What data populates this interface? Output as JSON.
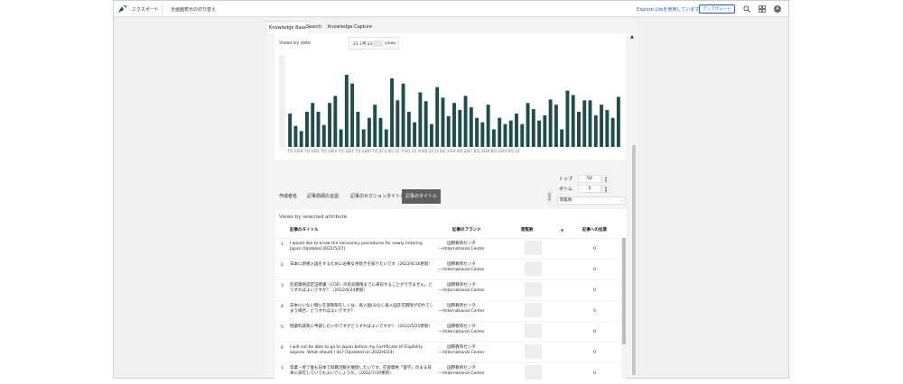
{
  "topbar": {
    "export_label": "エクスポート",
    "fullscreen_label": "全画面表示の切り替え",
    "explore_label": "Explore Lifeを使用しています",
    "upgrade_label": "アップグレード",
    "avatar_initial": "A",
    "icons": [
      "search-icon",
      "grid-icon",
      "apps-icon",
      "avatar"
    ]
  },
  "tabs": [
    "Knowledge Base",
    "Search",
    "Knowledge Capture"
  ],
  "chart": {
    "title": "Views by date",
    "tooltip_date": "21 7月 22",
    "tooltip_suffix": "views",
    "bar_color": "#1e4d4b"
  },
  "chart_data": {
    "type": "bar",
    "title": "Views by date",
    "x_tick_labels": [
      "15 7月 22",
      "18 7月 22",
      "21 7月 22",
      "24 7月 22",
      "27 7月 22",
      "30 7月 22",
      "2 8月 22",
      "5 8月 22",
      "8 8月 22",
      "11 8月 22",
      "14 8月 22",
      "17 8月 22",
      "20 8月 22",
      "23 8月 22"
    ],
    "values": [
      38,
      24,
      18,
      40,
      50,
      40,
      25,
      50,
      58,
      20,
      82,
      72,
      40,
      20,
      33,
      48,
      33,
      20,
      78,
      53,
      72,
      40,
      28,
      62,
      52,
      26,
      68,
      56,
      35,
      50,
      42,
      58,
      45,
      33,
      28,
      48,
      20,
      33,
      26,
      30,
      38,
      26,
      50,
      43,
      30,
      36,
      54,
      48,
      20,
      64,
      59,
      40,
      53,
      53,
      36,
      48,
      42,
      33,
      57
    ]
  },
  "attribute_tabs": [
    "作成者名",
    "記事前頭の言語",
    "記事のセクションタイトル",
    "記事のタイトル"
  ],
  "controls": {
    "top_label": "トップ",
    "top_value": "50",
    "bottom_label": "ボトム",
    "bottom_value": "0",
    "metric_value": "閲覧数"
  },
  "table": {
    "title": "Views by selected attribute",
    "headers": {
      "title": "記事のタイトル",
      "brand": "記事のブランド",
      "views": "閲覧数",
      "likes": "記事への投票"
    },
    "rows": [
      {
        "n": "1",
        "title": "I would like to know the necessary procedures for newly entering Japan (Updated 2022/5/27)",
        "brand": "国際教育センター/International Center",
        "likes": "0"
      },
      {
        "n": "2",
        "title": "日本に新規入国をするために必要な手続きを知りたいです（2022/6/16更新）",
        "brand": "国際教育センター/International Center",
        "likes": "0"
      },
      {
        "n": "3",
        "title": "在留資格認定証明書（COE）の有効期限までに来日することができません。どうすればよいですか？（2022/6/24更新）",
        "brand": "国際教育センター/International Center",
        "likes": "0"
      },
      {
        "n": "4",
        "title": "日本にいない間に在留期限をしくは、再入国(みなし再入国許可期限が切れてしまう場合、どうすればよいですか？",
        "brand": "国際教育センター/International Center",
        "likes": "0"
      },
      {
        "n": "5",
        "title": "授業料減免に申請したいのですがどうすればよいですか？（2022/5/25更新）",
        "brand": "国際教育センター/International Center",
        "likes": "0"
      },
      {
        "n": "6",
        "title": "I will not be able to go to Japan before my Certificate of Eligibility expires. What should I do? (Updated on 2022/6/24)",
        "brand": "国際教育センター/International Center",
        "likes": "0"
      },
      {
        "n": "7",
        "title": "卒業・修了後も日本で就職活動を継続したいです。在留資格「留学」のまま日本に滞在していてもよいでしょうか。（2022/7/29更新）",
        "brand": "国際教育センター/International Center",
        "likes": "0"
      }
    ]
  }
}
